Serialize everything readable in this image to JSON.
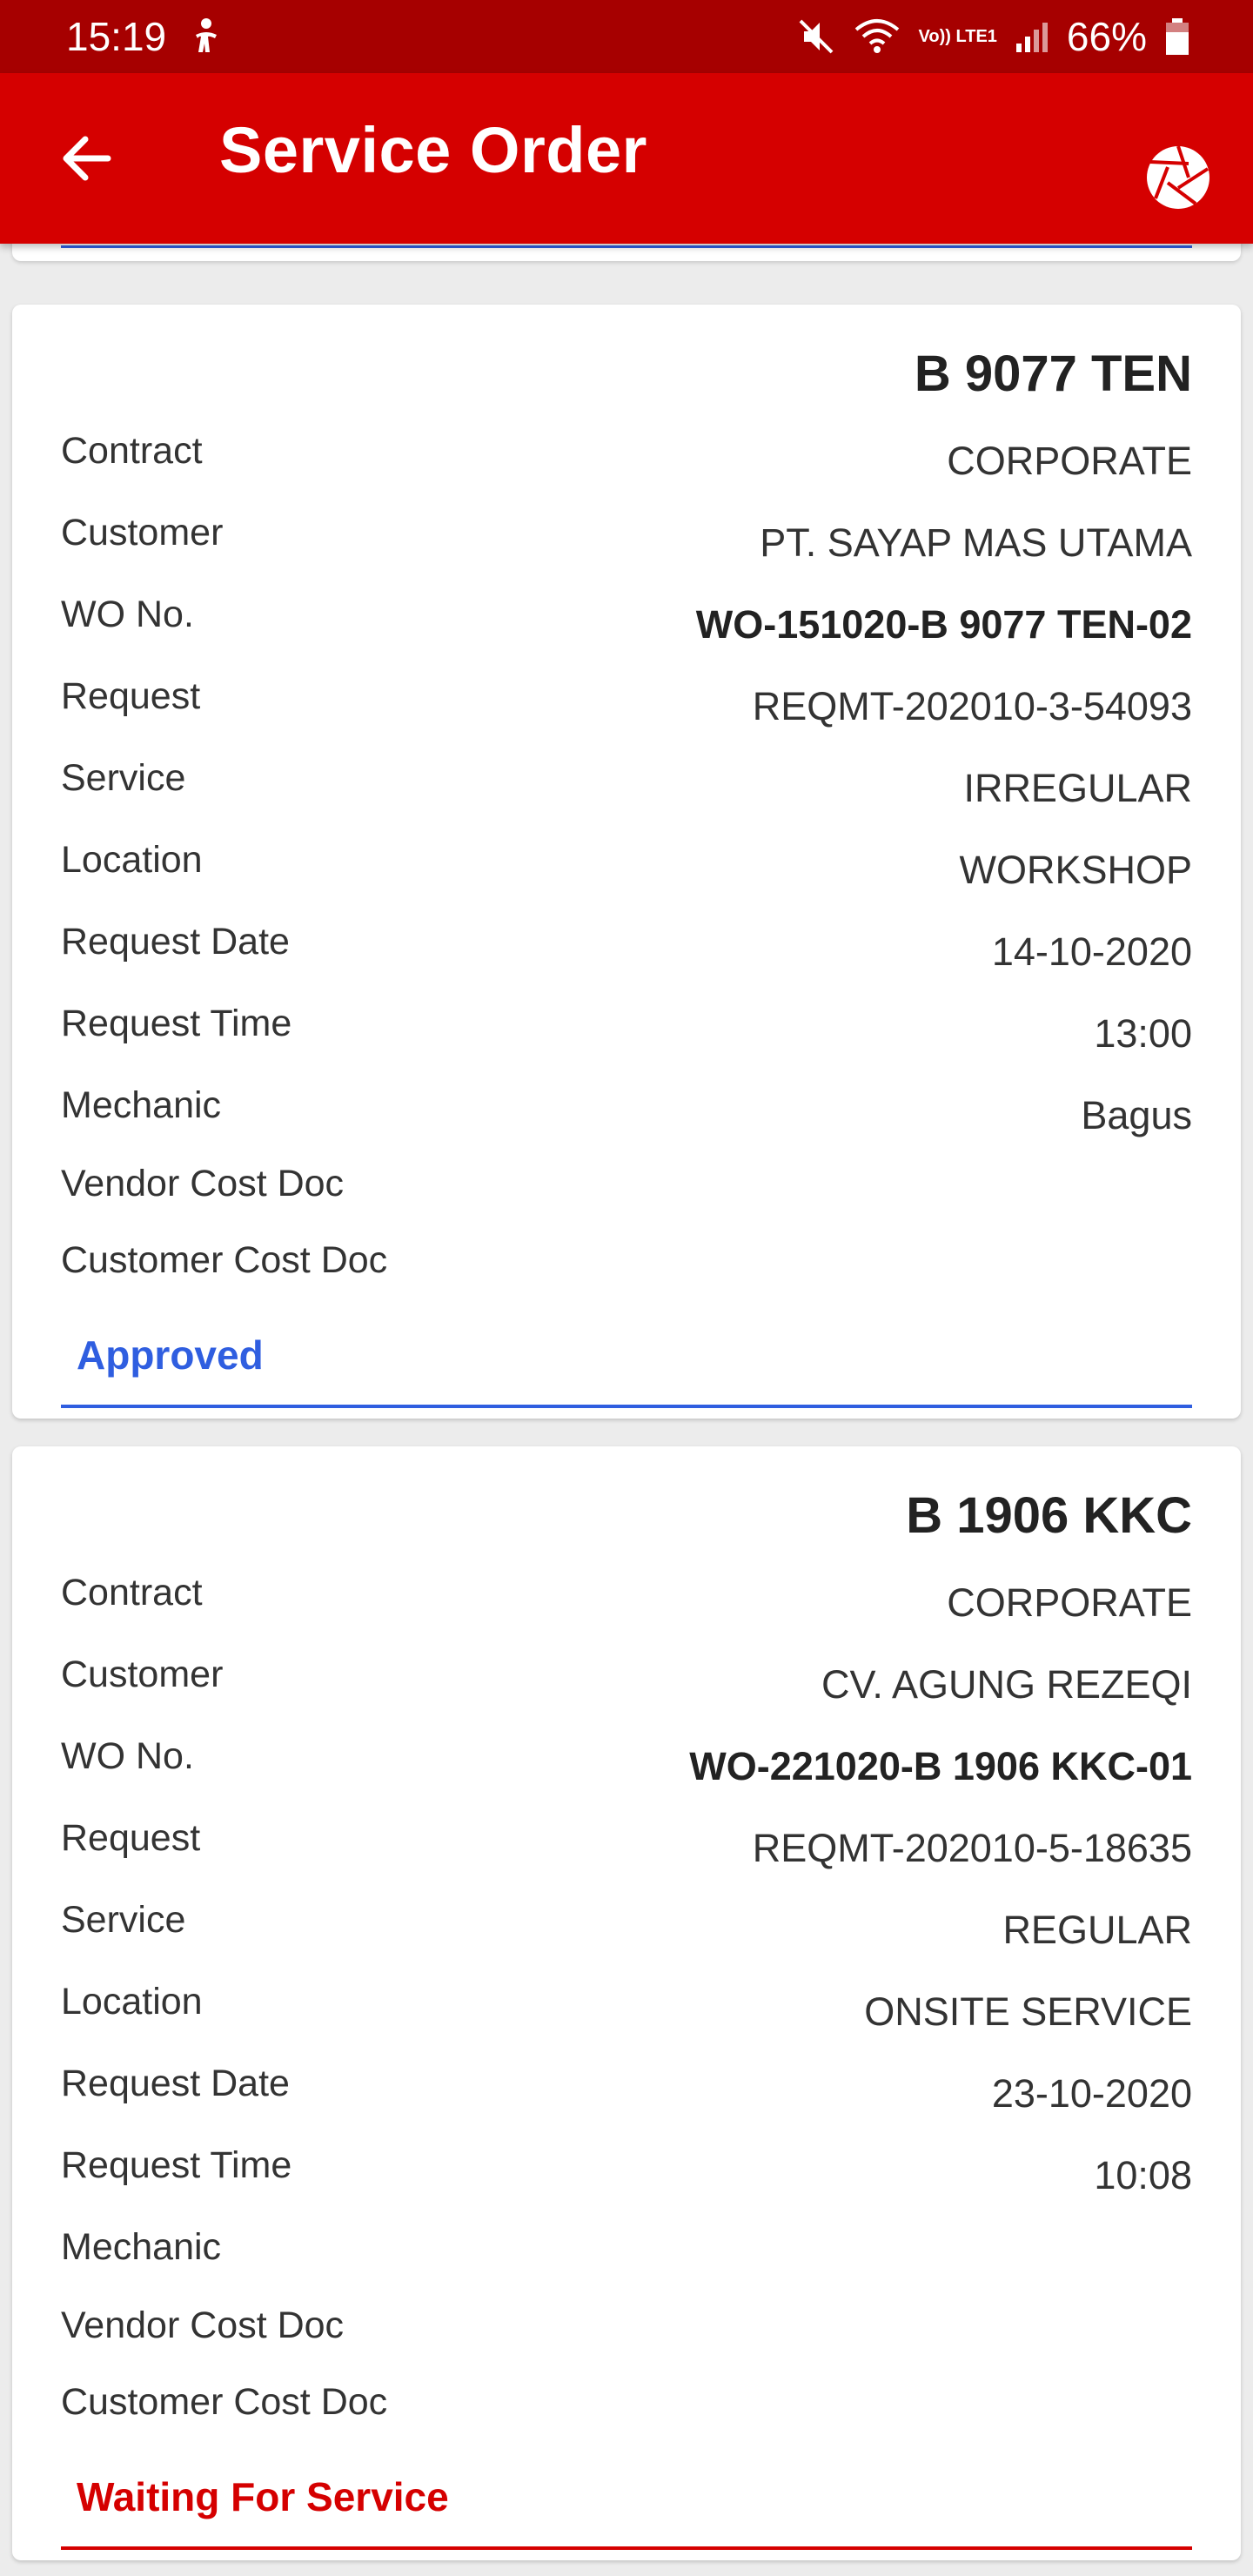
{
  "status_bar": {
    "time": "15:19",
    "battery": "66%",
    "network": "Vo)) LTE1"
  },
  "app_bar": {
    "title": "Service Order"
  },
  "labels": {
    "contract": "Contract",
    "customer": "Customer",
    "wo_no": "WO No.",
    "request": "Request",
    "service": "Service",
    "location": "Location",
    "request_date": "Request Date",
    "request_time": "Request Time",
    "mechanic": "Mechanic",
    "vendor_cost_doc": "Vendor Cost Doc",
    "customer_cost_doc": "Customer Cost Doc"
  },
  "orders": [
    {
      "plate": "B 9077 TEN",
      "contract": "CORPORATE",
      "customer": "PT. SAYAP MAS UTAMA",
      "wo_no": "WO-151020-B 9077 TEN-02",
      "request": "REQMT-202010-3-54093",
      "service": "IRREGULAR",
      "location": "WORKSHOP",
      "request_date": "14-10-2020",
      "request_time": "13:00",
      "mechanic": "Bagus",
      "vendor_cost_doc": "",
      "customer_cost_doc": "",
      "status": "Approved",
      "status_color": "#2f5ee0"
    },
    {
      "plate": "B 1906 KKC",
      "contract": "CORPORATE",
      "customer": "CV. AGUNG REZEQI",
      "wo_no": "WO-221020-B 1906 KKC-01",
      "request": "REQMT-202010-5-18635",
      "service": "REGULAR",
      "location": "ONSITE SERVICE",
      "request_date": "23-10-2020",
      "request_time": "10:08",
      "mechanic": "",
      "vendor_cost_doc": "",
      "customer_cost_doc": "",
      "status": "Waiting For Service",
      "status_color": "#d50000"
    }
  ]
}
